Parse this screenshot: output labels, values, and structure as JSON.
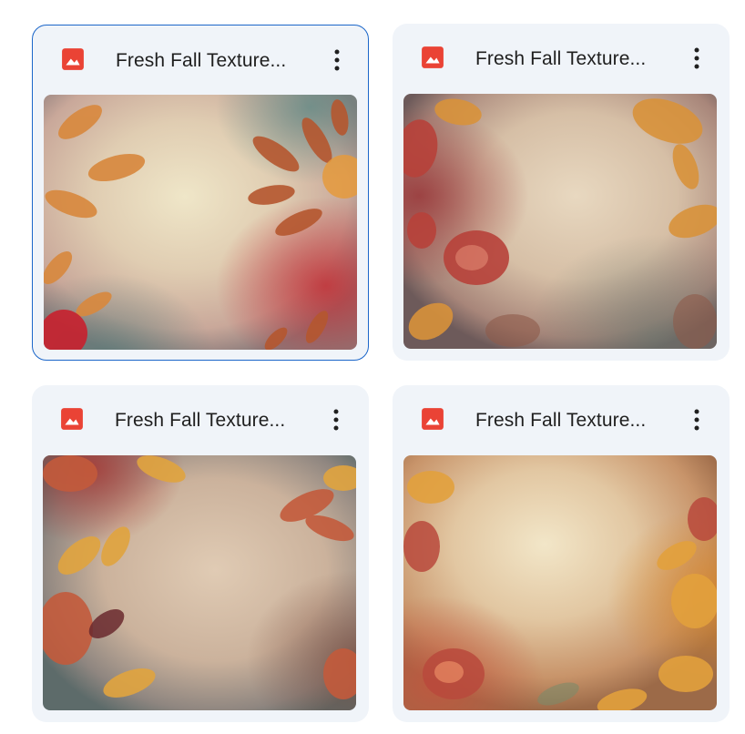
{
  "files": [
    {
      "title": "Fresh Fall Texture...",
      "icon": "image-file-icon",
      "more_icon": "more-vert-icon",
      "selected": true,
      "preview": "fall-texture-preview-1"
    },
    {
      "title": "Fresh Fall Texture...",
      "icon": "image-file-icon",
      "more_icon": "more-vert-icon",
      "selected": false,
      "preview": "fall-texture-preview-2"
    },
    {
      "title": "Fresh Fall Texture...",
      "icon": "image-file-icon",
      "more_icon": "more-vert-icon",
      "selected": false,
      "preview": "fall-texture-preview-3"
    },
    {
      "title": "Fresh Fall Texture...",
      "icon": "image-file-icon",
      "more_icon": "more-vert-icon",
      "selected": false,
      "preview": "fall-texture-preview-4"
    }
  ],
  "colors": {
    "card_background": "#f0f4f9",
    "selected_border": "#1b66c9",
    "image_icon": "#ea4335",
    "title_text": "#1f1f1f"
  }
}
